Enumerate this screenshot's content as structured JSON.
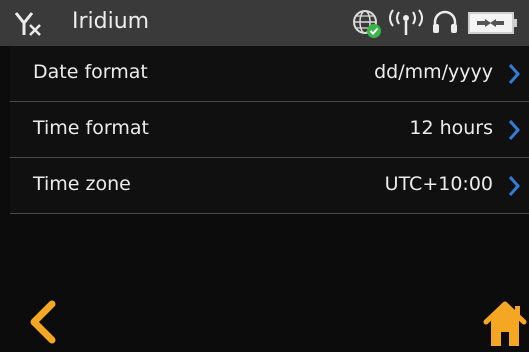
{
  "header": {
    "title": "Iridium"
  },
  "settings": [
    {
      "label": "Date format",
      "value": "dd/mm/yyyy"
    },
    {
      "label": "Time format",
      "value": "12 hours"
    },
    {
      "label": "Time zone",
      "value": "UTC+10:00"
    }
  ],
  "colors": {
    "accent": "#f5a623",
    "chevron": "#2f7fd6",
    "status_ok": "#39b54a",
    "header_bg": "#3a3a3a"
  },
  "icons": {
    "signal": "signal-no-service-icon",
    "globe": "globe-check-icon",
    "antenna": "antenna-broadcast-icon",
    "headset": "headset-icon",
    "power": "power-plug-icon",
    "back": "chevron-left-icon",
    "home": "home-icon",
    "row_chevron": "chevron-right-icon"
  }
}
